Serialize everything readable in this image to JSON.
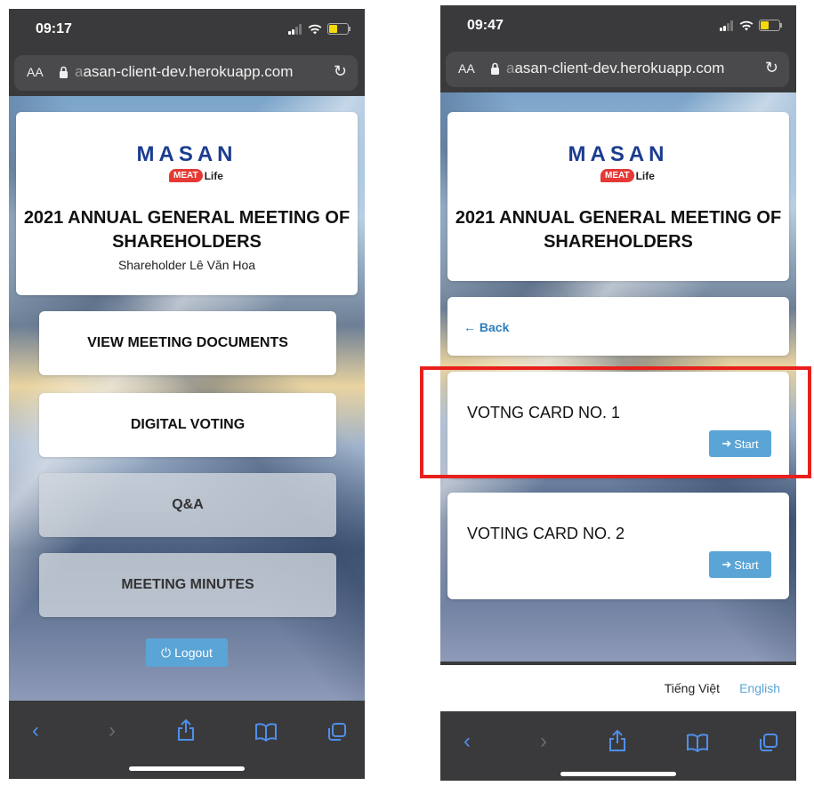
{
  "left_screen": {
    "status_time": "09:17",
    "url_prefix": "a",
    "url": "asan-client-dev.herokuapp.com",
    "aa": "AA",
    "brand": "MASAN",
    "brand_sub_badge": "MEAT",
    "brand_sub_life": "Life",
    "meeting_title": "2021 ANNUAL GENERAL MEETING OF SHAREHOLDERS",
    "shareholder": "Shareholder Lê Văn Hoa",
    "menu": [
      {
        "label": "VIEW MEETING DOCUMENTS"
      },
      {
        "label": "DIGITAL VOTING"
      },
      {
        "label": "Q&A"
      },
      {
        "label": "MEETING MINUTES"
      }
    ],
    "logout_label": "Logout"
  },
  "right_screen": {
    "status_time": "09:47",
    "url_prefix": "a",
    "url": "asan-client-dev.herokuapp.com",
    "aa": "AA",
    "brand": "MASAN",
    "brand_sub_badge": "MEAT",
    "brand_sub_life": "Life",
    "meeting_title": "2021 ANNUAL GENERAL MEETING OF SHAREHOLDERS",
    "back_label": "Back",
    "voting_cards": [
      {
        "title": "VOTNG CARD NO. 1",
        "start_label": "Start"
      },
      {
        "title": "VOTING CARD NO. 2",
        "start_label": "Start"
      }
    ],
    "lang_vi": "Tiếng Việt",
    "lang_en": "English"
  },
  "colors": {
    "accent": "#5aa5d6",
    "link": "#2a7ec0",
    "highlight": "#e8201c",
    "brand": "#1b3d8f"
  },
  "icons": [
    "lock-icon",
    "reload-icon",
    "back-nav-icon",
    "forward-nav-icon",
    "share-icon",
    "bookmarks-icon",
    "tabs-icon",
    "power-icon",
    "arrow-right-icon",
    "arrow-left-icon"
  ]
}
